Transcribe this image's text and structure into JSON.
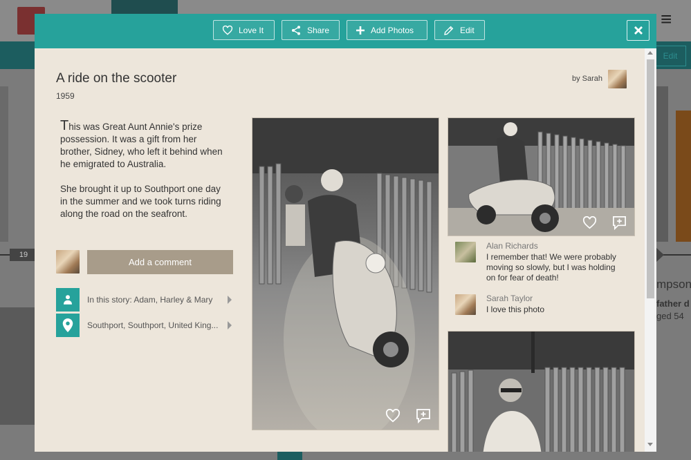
{
  "background": {
    "year_label": "19",
    "edit_label": "Edit",
    "person_name_partial": "mpson",
    "relation_partial": "father d",
    "age_partial": "ged 54"
  },
  "toolbar": {
    "love_label": "Love It",
    "share_label": "Share",
    "add_photos_label": "Add Photos",
    "edit_label": "Edit",
    "close_icon": "close-icon"
  },
  "story": {
    "title": "A ride on the scooter",
    "year": "1959",
    "by_label": "by Sarah",
    "description": {
      "dropcap": "T",
      "p1_rest": "his was Great Aunt Annie's prize possession. It was a gift from her brother, Sidney, who left it behind when he emigrated to Australia.",
      "p2": "She brought it up to Southport one day in the summer and we took turns riding along the road on the seafront."
    },
    "add_comment_label": "Add a comment",
    "people": "In this story: Adam, Harley & Mary",
    "location": "Southport, Southport, United King..."
  },
  "comments": [
    {
      "name": "Alan Richards",
      "text": "I remember that! We were probably moving so slowly, but I was holding on for fear of death!"
    },
    {
      "name": "Sarah Taylor",
      "text": "I love this photo"
    }
  ],
  "colors": {
    "teal": "#26a29b",
    "panel": "#ede6db",
    "comment_button": "#a89c8a"
  }
}
